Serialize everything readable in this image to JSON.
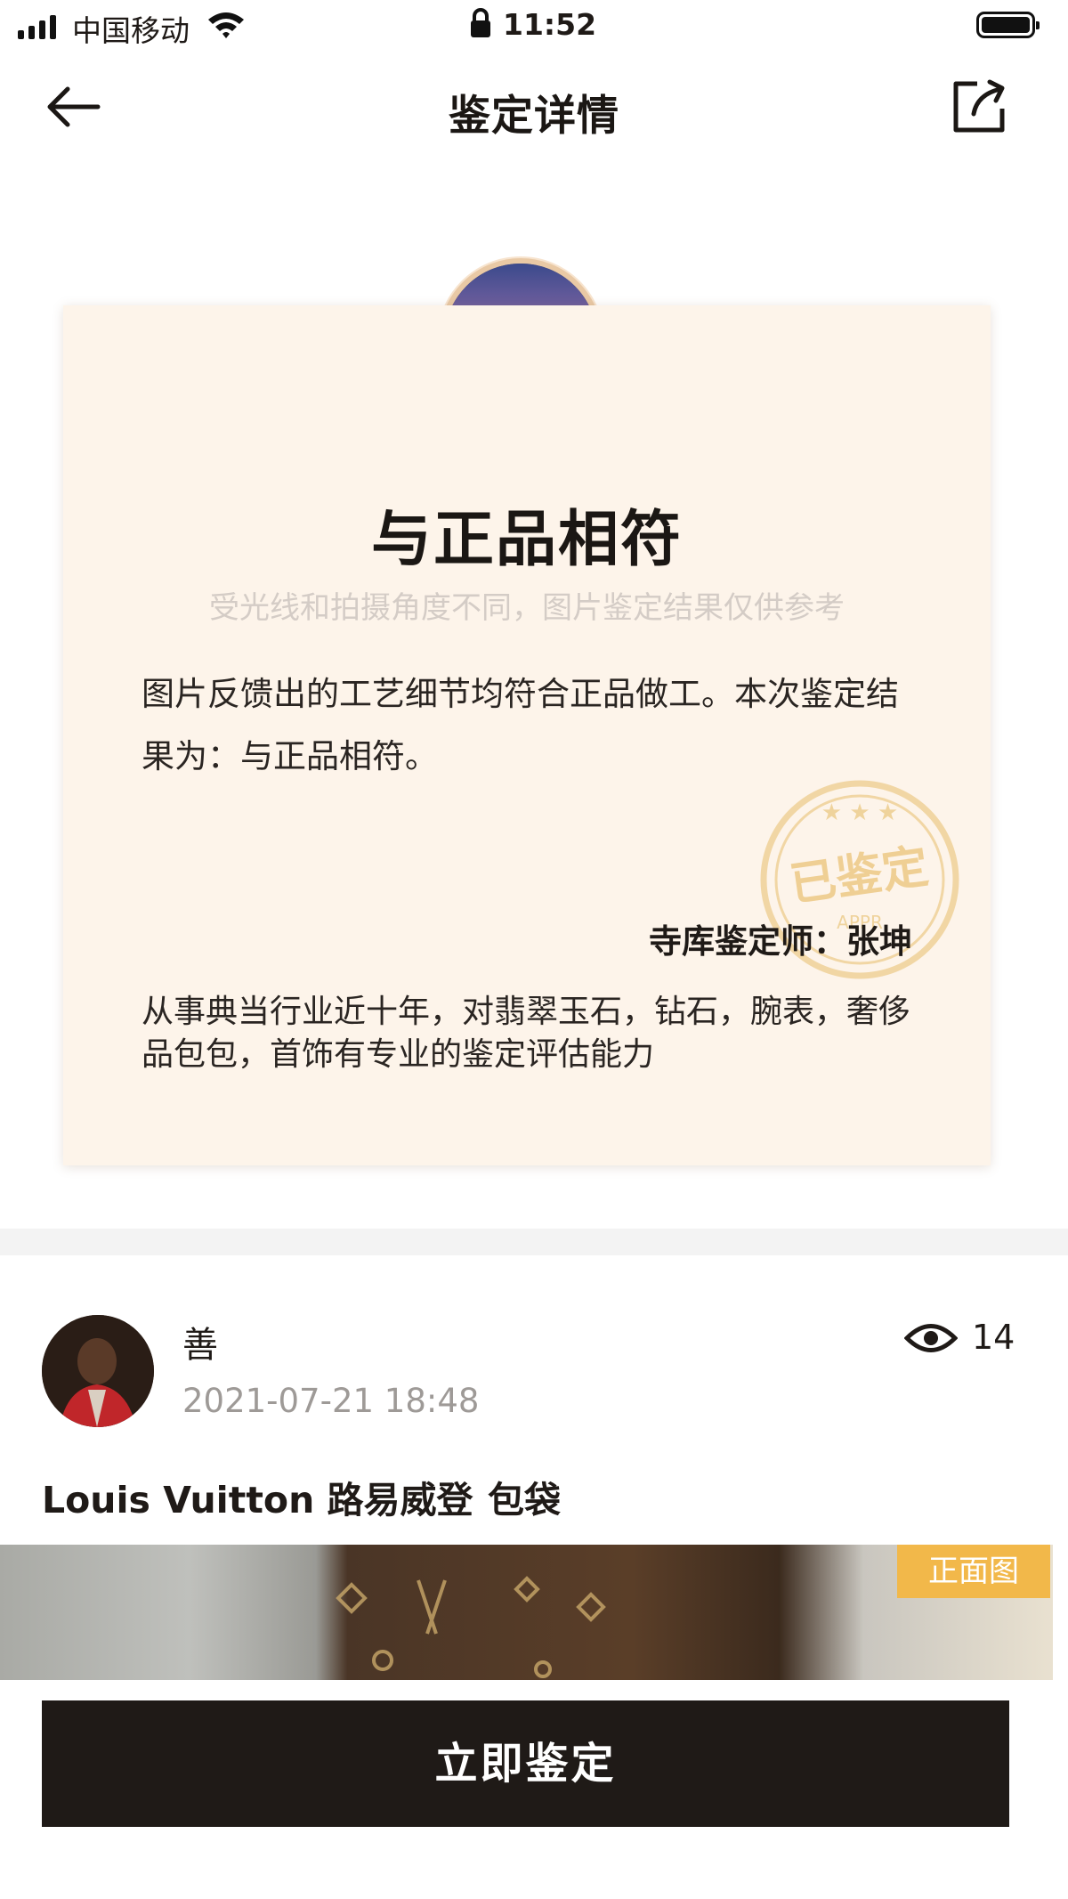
{
  "status_bar": {
    "carrier": "中国移动",
    "time": "11:52"
  },
  "nav": {
    "title": "鉴定详情"
  },
  "certificate": {
    "result": "与正品相符",
    "disclaimer": "受光线和拍摄角度不同，图片鉴定结果仅供参考",
    "description": "图片反馈出的工艺细节均符合正品做工。本次鉴定结果为：与正品相符。",
    "appraiser_label": "寺库鉴定师：张坤",
    "appraiser_bio": "从事典当行业近十年，对翡翠玉石，钻石，腕表，奢侈品包包，首饰有专业的鉴定评估能力",
    "stamp": {
      "text": "已鉴定",
      "subtext": "APPR"
    }
  },
  "post": {
    "username": "善",
    "timestamp": "2021-07-21 18:48",
    "views": "14",
    "brand": "Louis Vuitton 路易威登",
    "category": "包袋",
    "photo_tag": "正面图"
  },
  "cta": {
    "label": "立即鉴定"
  },
  "colors": {
    "cta_bg": "#1f1a17",
    "card_bg": "#fdf4ea",
    "tag_bg": "#f2b84a"
  }
}
